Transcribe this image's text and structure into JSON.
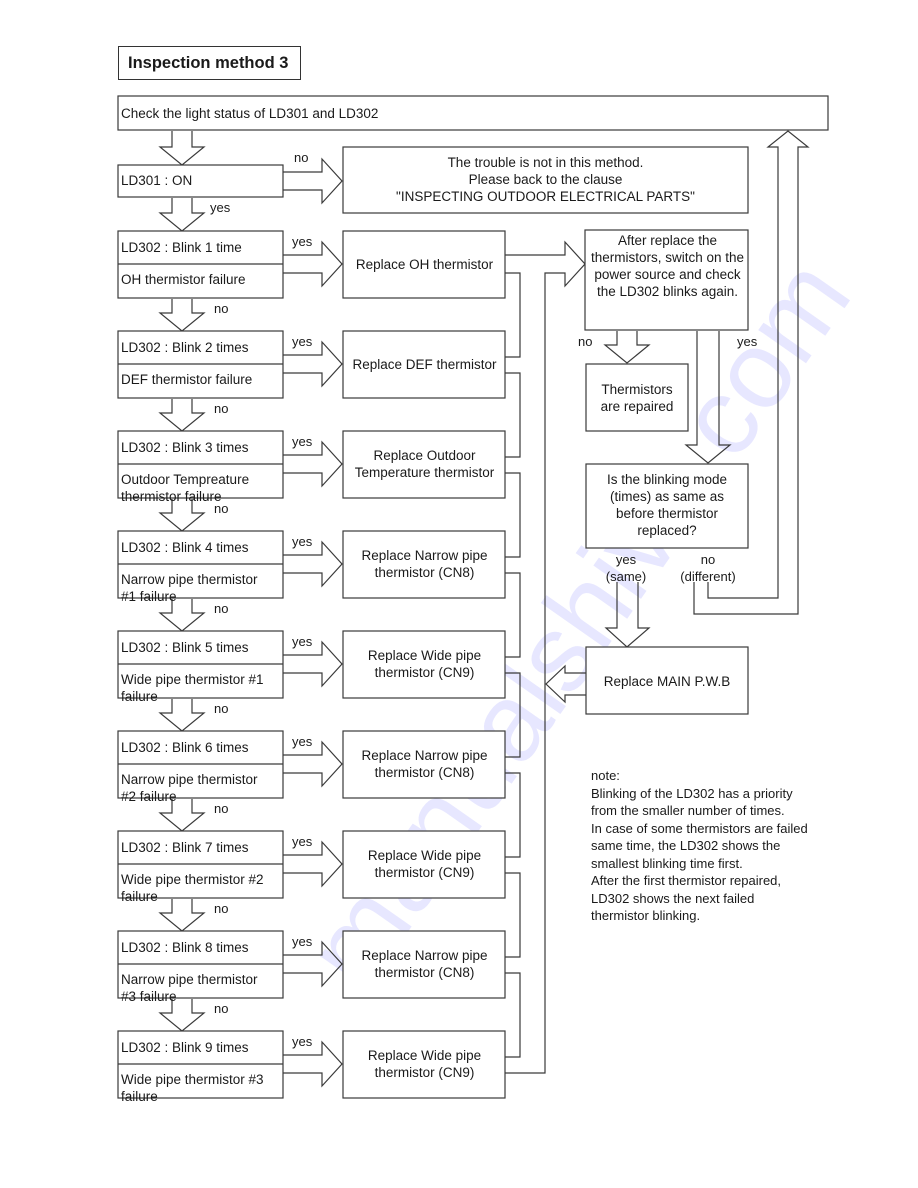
{
  "title": "Inspection method 3",
  "start": "Check the light status of LD301 and LD302",
  "ld301": {
    "label": "LD301 : ON",
    "no_label": "no",
    "yes_label": "yes",
    "not_in_method": "The trouble is not in this method.\nPlease back to the clause\n\"INSPECTING OUTDOOR ELECTRICAL PARTS\""
  },
  "steps": [
    {
      "condition": "LD302 : Blink 1 time",
      "failure": "OH thermistor failure",
      "action": "Replace OH thermistor",
      "yes_label": "yes",
      "no_label": "no"
    },
    {
      "condition": "LD302 : Blink 2 times",
      "failure": "DEF thermistor failure",
      "action": "Replace DEF thermistor",
      "yes_label": "yes",
      "no_label": "no"
    },
    {
      "condition": "LD302 : Blink 3 times",
      "failure": "Outdoor Tempreature thermistor failure",
      "action": "Replace Outdoor Temperature thermistor",
      "yes_label": "yes",
      "no_label": "no"
    },
    {
      "condition": "LD302 : Blink 4 times",
      "failure": "Narrow pipe thermistor #1 failure",
      "action": "Replace Narrow pipe thermistor (CN8)",
      "yes_label": "yes",
      "no_label": "no"
    },
    {
      "condition": "LD302 : Blink 5 times",
      "failure": "Wide pipe thermistor #1 failure",
      "action": "Replace Wide pipe thermistor (CN9)",
      "yes_label": "yes",
      "no_label": "no"
    },
    {
      "condition": "LD302 : Blink 6 times",
      "failure": "Narrow pipe thermistor #2 failure",
      "action": "Replace Narrow pipe thermistor (CN8)",
      "yes_label": "yes",
      "no_label": "no"
    },
    {
      "condition": "LD302 : Blink 7 times",
      "failure": "Wide pipe thermistor #2 failure",
      "action": "Replace Wide pipe thermistor (CN9)",
      "yes_label": "yes",
      "no_label": "no"
    },
    {
      "condition": "LD302 : Blink 8 times",
      "failure": "Narrow pipe thermistor #3 failure",
      "action": "Replace Narrow pipe thermistor (CN8)",
      "yes_label": "yes",
      "no_label": "no"
    },
    {
      "condition": "LD302 : Blink 9 times",
      "failure": "Wide pipe thermistor #3 failure",
      "action": "Replace Wide pipe thermistor (CN9)",
      "yes_label": "yes",
      "no_label": ""
    }
  ],
  "after_replace": "After replace the thermistors, switch on the power source and check the LD302 blinks again.",
  "after_no_label": "no",
  "after_yes_label": "yes",
  "repaired": "Thermistors are repaired",
  "question": "Is the blinking mode (times) as same as before thermistor replaced?",
  "question_yes_label": "yes\n(same)",
  "question_no_label": "no\n(different)",
  "replace_main": "Replace MAIN P.W.B",
  "note": [
    "note:",
    "Blinking of the LD302 has a priority",
    "from the smaller number of times.",
    "In case of some thermistors are failed",
    "same time, the LD302 shows the",
    "smallest blinking time first.",
    "After the first thermistor repaired,",
    "LD302 shows the next failed",
    "thermistor blinking."
  ],
  "watermark": "manualshive.com"
}
